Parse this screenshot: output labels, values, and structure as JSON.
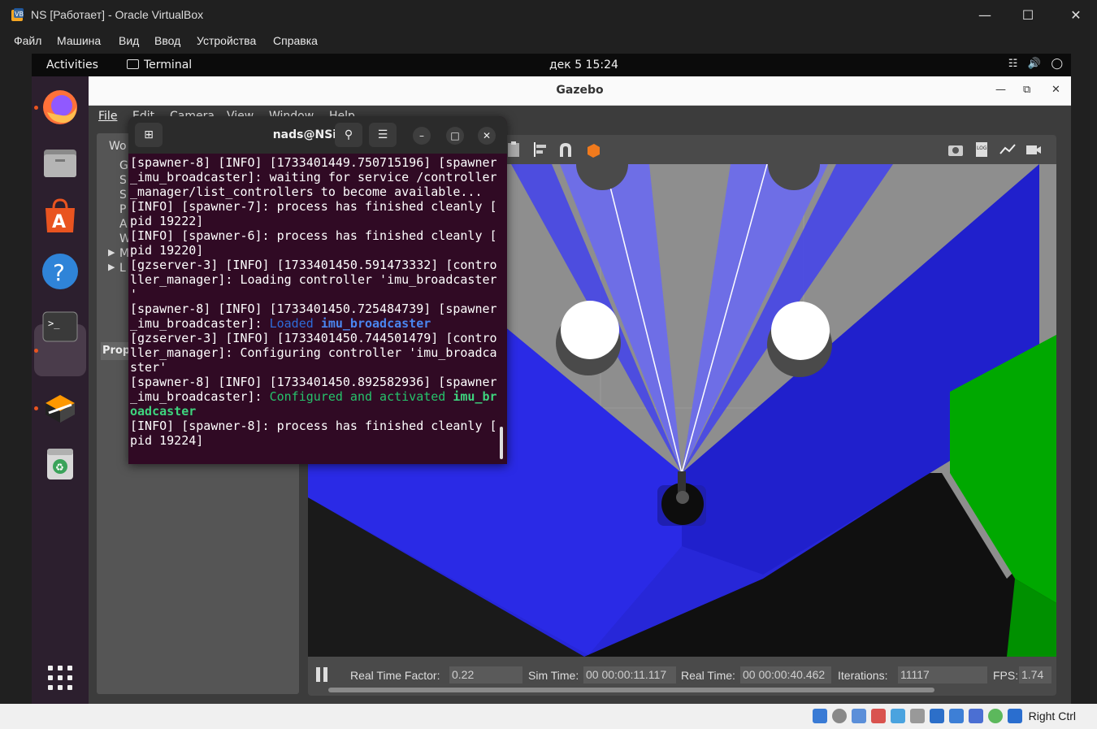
{
  "host": {
    "title": "NS [Работает] - Oracle VirtualBox",
    "menu": [
      "Файл",
      "Машина",
      "Вид",
      "Ввод",
      "Устройства",
      "Справка"
    ],
    "host_key": "Right Ctrl"
  },
  "guest": {
    "activities": "Activities",
    "focused_app": "Terminal",
    "clock": "дек 5  15:24"
  },
  "dock": {
    "items": [
      "firefox-icon",
      "files-icon",
      "app-center-icon",
      "help-icon",
      "terminal-icon",
      "sublime-icon",
      "trash-icon",
      "app-grid-icon"
    ]
  },
  "gazebo": {
    "title": "Gazebo",
    "menu": [
      "File",
      "Edit",
      "Camera",
      "View",
      "Window",
      "Help"
    ],
    "left_panel": {
      "tab": "Wo",
      "items": [
        "G",
        "S",
        "S",
        "P",
        "A",
        "W",
        "M",
        "L"
      ],
      "props_tab": "Prop"
    },
    "status": {
      "rtf_label": "Real Time Factor:",
      "rtf_value": "0.22",
      "sim_label": "Sim Time:",
      "sim_value": "00 00:00:11.117",
      "real_label": "Real Time:",
      "real_value": "00 00:00:40.462",
      "iter_label": "Iterations:",
      "iter_value": "11117",
      "fps_label": "FPS:",
      "fps_value": "1.74"
    }
  },
  "terminal": {
    "title": "nads@NSib: ~",
    "lines": [
      "[spawner-8] [INFO] [1733401449.750715196] [spawner",
      "_imu_broadcaster]: waiting for service /controller",
      "_manager/list_controllers to become available...",
      "[INFO] [spawner-7]: process has finished cleanly [",
      "pid 19222]",
      "[INFO] [spawner-6]: process has finished cleanly [",
      "pid 19220]",
      "[gzserver-3] [INFO] [1733401450.591473332] [contro",
      "ller_manager]: Loading controller 'imu_broadcaster",
      "'",
      "[spawner-8] [INFO] [1733401450.725484739] [spawner",
      "[gzserver-3] [INFO] [1733401450.744501479] [contro",
      "ller_manager]: Configuring controller 'imu_broadca",
      "ster'",
      "[spawner-8] [INFO] [1733401450.892582936] [spawner",
      "[INFO] [spawner-8]: process has finished cleanly [",
      "pid 19224]"
    ],
    "line_loaded_prefix": "_imu_broadcaster]: ",
    "line_loaded_word": "Loaded ",
    "line_loaded_name": "imu_broadcaster",
    "line_conf_prefix": "_imu_broadcaster]: ",
    "line_conf_word": "Configured and activated ",
    "line_conf_name_a": "imu_br",
    "line_conf_name_b": "oadcaster"
  }
}
